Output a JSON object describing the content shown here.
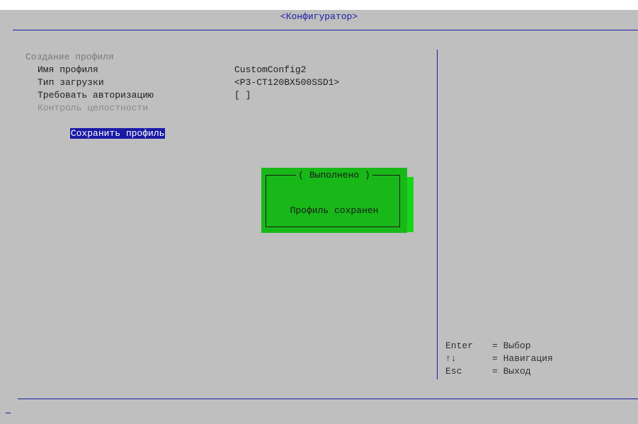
{
  "window": {
    "title": "<Конфигуратор>"
  },
  "menu": {
    "section": "Создание профиля",
    "items": [
      {
        "label": "Имя профиля",
        "value": "CustomConfig2"
      },
      {
        "label": "Тип загрузки",
        "value": "<P3-CT120BX500SSD1>"
      },
      {
        "label": "Требовать авторизацию",
        "value": "[ ]"
      },
      {
        "label": "Контроль целостности",
        "value": ""
      },
      {
        "label": "Сохранить профиль",
        "value": ""
      }
    ]
  },
  "dialog": {
    "title": "( Выполнено )",
    "message": "Профиль сохранен"
  },
  "help": [
    {
      "key": "Enter",
      "desc": "= Выбор"
    },
    {
      "key": "↑↓",
      "desc": "= Навигация"
    },
    {
      "key": "Esc",
      "desc": "= Выход"
    }
  ],
  "colors": {
    "background": "#bfbfbf",
    "accent": "#1a1aa6",
    "dialog": "#19b819",
    "dialog_shadow": "#19d419"
  }
}
